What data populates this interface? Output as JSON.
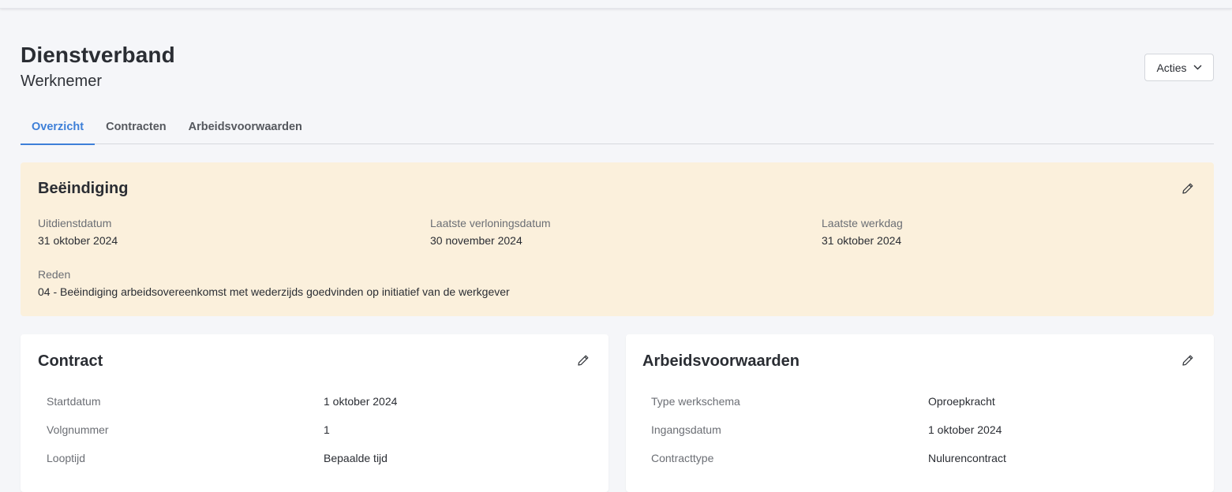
{
  "header": {
    "title": "Dienstverband",
    "subtitle": "Werknemer",
    "actions_label": "Acties"
  },
  "tabs": [
    {
      "label": "Overzicht",
      "active": true
    },
    {
      "label": "Contracten",
      "active": false
    },
    {
      "label": "Arbeidsvoorwaarden",
      "active": false
    }
  ],
  "termination": {
    "title": "Beëindiging",
    "fields": [
      {
        "label": "Uitdienstdatum",
        "value": "31 oktober 2024"
      },
      {
        "label": "Laatste verloningsdatum",
        "value": "30 november 2024"
      },
      {
        "label": "Laatste werkdag",
        "value": "31 oktober 2024"
      }
    ],
    "reason": {
      "label": "Reden",
      "value": "04 - Beëindiging arbeidsovereenkomst met wederzijds goedvinden op initiatief van de werkgever"
    }
  },
  "contract": {
    "title": "Contract",
    "rows": [
      {
        "label": "Startdatum",
        "value": "1 oktober 2024"
      },
      {
        "label": "Volgnummer",
        "value": "1"
      },
      {
        "label": "Looptijd",
        "value": "Bepaalde tijd"
      }
    ]
  },
  "conditions": {
    "title": "Arbeidsvoorwaarden",
    "rows": [
      {
        "label": "Type werkschema",
        "value": "Oproepkracht"
      },
      {
        "label": "Ingangsdatum",
        "value": "1 oktober 2024"
      },
      {
        "label": "Contracttype",
        "value": "Nulurencontract"
      }
    ]
  },
  "colors": {
    "accent": "#3d7fd8",
    "termination_bg": "#fbf0dc",
    "page_bg": "#f5f6f9"
  },
  "icons": {
    "edit": "pencil-icon",
    "dropdown": "chevron-down-icon"
  }
}
